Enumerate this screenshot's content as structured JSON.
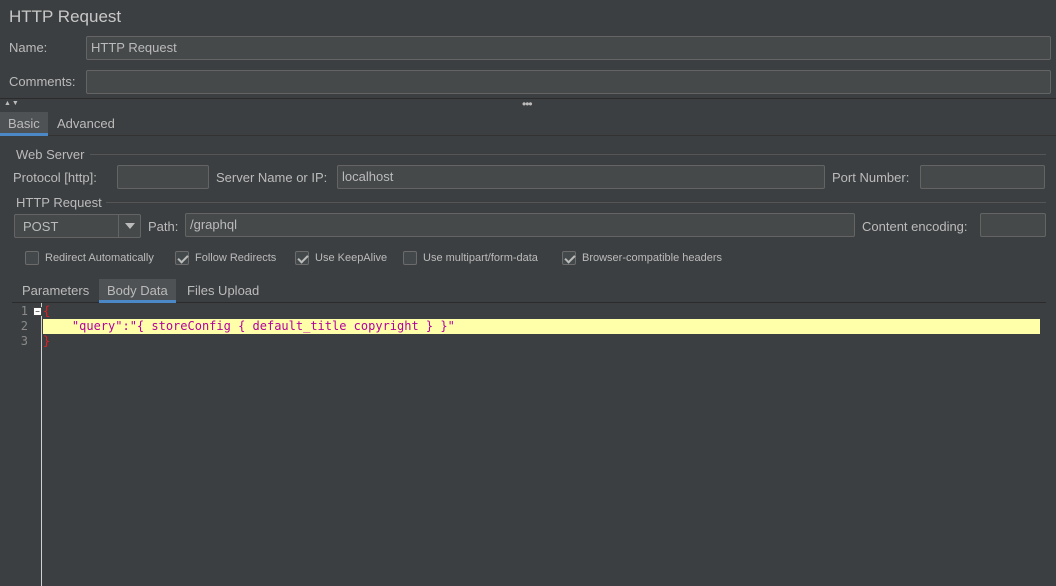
{
  "header": {
    "title": "HTTP Request"
  },
  "form": {
    "name_label": "Name:",
    "name_value": "HTTP Request",
    "comments_label": "Comments:",
    "comments_value": ""
  },
  "top_tabs": [
    {
      "label": "Basic",
      "selected": true
    },
    {
      "label": "Advanced",
      "selected": false
    }
  ],
  "web_server": {
    "section_title": "Web Server",
    "protocol_label": "Protocol [http]:",
    "protocol_value": "",
    "server_label": "Server Name or IP:",
    "server_value": "localhost",
    "port_label": "Port Number:",
    "port_value": ""
  },
  "http_request": {
    "section_title": "HTTP Request",
    "method": "POST",
    "path_label": "Path:",
    "path_value": "/graphql",
    "encoding_label": "Content encoding:",
    "encoding_value": ""
  },
  "options": [
    {
      "label": "Redirect Automatically",
      "checked": false
    },
    {
      "label": "Follow Redirects",
      "checked": true
    },
    {
      "label": "Use KeepAlive",
      "checked": true
    },
    {
      "label": "Use multipart/form-data",
      "checked": false
    },
    {
      "label": "Browser-compatible headers",
      "checked": true
    }
  ],
  "sub_tabs": [
    {
      "label": "Parameters",
      "selected": false
    },
    {
      "label": "Body Data",
      "selected": true
    },
    {
      "label": "Files Upload",
      "selected": false
    }
  ],
  "editor": {
    "line_numbers": [
      "1",
      "2",
      "3"
    ],
    "line1": "{",
    "line2_indent": "    ",
    "line2_key": "\"query\":\"{ storeConfig { default_title copyright } }\"",
    "line3": "}",
    "colors": {
      "highlight": "#ffffaa",
      "brace": "#e02020",
      "string": "#b4009e"
    }
  }
}
